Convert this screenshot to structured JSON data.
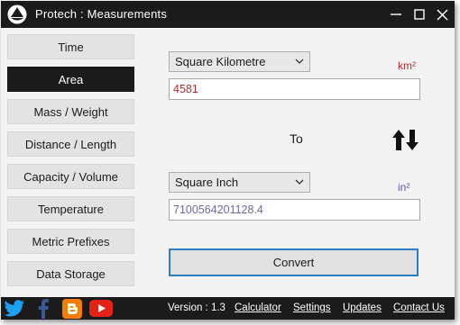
{
  "window": {
    "title": "Protech : Measurements",
    "controls": [
      "minimize",
      "maximize",
      "close"
    ]
  },
  "sidebar": {
    "items": [
      {
        "label": "Time",
        "active": false
      },
      {
        "label": "Area",
        "active": true
      },
      {
        "label": "Mass / Weight",
        "active": false
      },
      {
        "label": "Distance / Length",
        "active": false
      },
      {
        "label": "Capacity / Volume",
        "active": false
      },
      {
        "label": "Temperature",
        "active": false
      },
      {
        "label": "Metric Prefixes",
        "active": false
      },
      {
        "label": "Data Storage",
        "active": false
      }
    ]
  },
  "converter": {
    "from_unit": "Square Kilometre",
    "from_symbol": "km²",
    "from_value": "4581",
    "to_label": "To",
    "to_unit": "Square Inch",
    "to_symbol": "in²",
    "to_value": "7100564201128.4",
    "convert_label": "Convert"
  },
  "footer": {
    "version": "Version : 1.3",
    "links": [
      "Calculator",
      "Settings",
      "Updates",
      "Contact Us"
    ],
    "social_icons": [
      "twitter-icon",
      "facebook-icon",
      "blogger-icon",
      "youtube-icon"
    ]
  },
  "colors": {
    "dark_bar": "#1b1b1b",
    "from_symbol": "#b02a2a",
    "to_symbol": "#5b5bb0",
    "from_value_text": "#b03030",
    "to_value_text": "#6a6aa0",
    "convert_border": "#2d7fc1",
    "twitter": "#1da1f2",
    "facebook": "#3b5998",
    "blogger": "#f57d00",
    "youtube": "#e62117"
  }
}
